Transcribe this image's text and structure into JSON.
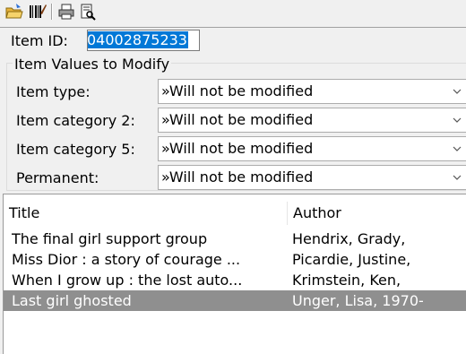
{
  "toolbar": {
    "icons": [
      "open-folder-icon",
      "barcode-icon",
      "print-icon",
      "preview-icon"
    ]
  },
  "item_id": {
    "label": "Item ID:",
    "value": "04002875233"
  },
  "modify_group": {
    "legend": "Item Values to Modify",
    "rows": [
      {
        "label": "Item type:",
        "value": "»Will not be modified"
      },
      {
        "label": "Item category 2:",
        "value": "»Will not be modified"
      },
      {
        "label": "Item category 5:",
        "value": "»Will not be modified"
      },
      {
        "label": "Permanent:",
        "value": "»Will not be modified"
      }
    ]
  },
  "list": {
    "columns": {
      "title": "Title",
      "author": "Author"
    },
    "rows": [
      {
        "title": "The final girl support group",
        "author": "Hendrix, Grady,"
      },
      {
        "title": "Miss Dior : a story of courage ...",
        "author": "Picardie, Justine,"
      },
      {
        "title": "When I grow up : the lost auto...",
        "author": "Krimstein, Ken,"
      },
      {
        "title": "Last girl ghosted",
        "author": "Unger, Lisa, 1970-"
      }
    ],
    "selected_index": 3
  },
  "colors": {
    "selection_highlight": "#0078d7",
    "selected_row": "#8f8f8f"
  }
}
